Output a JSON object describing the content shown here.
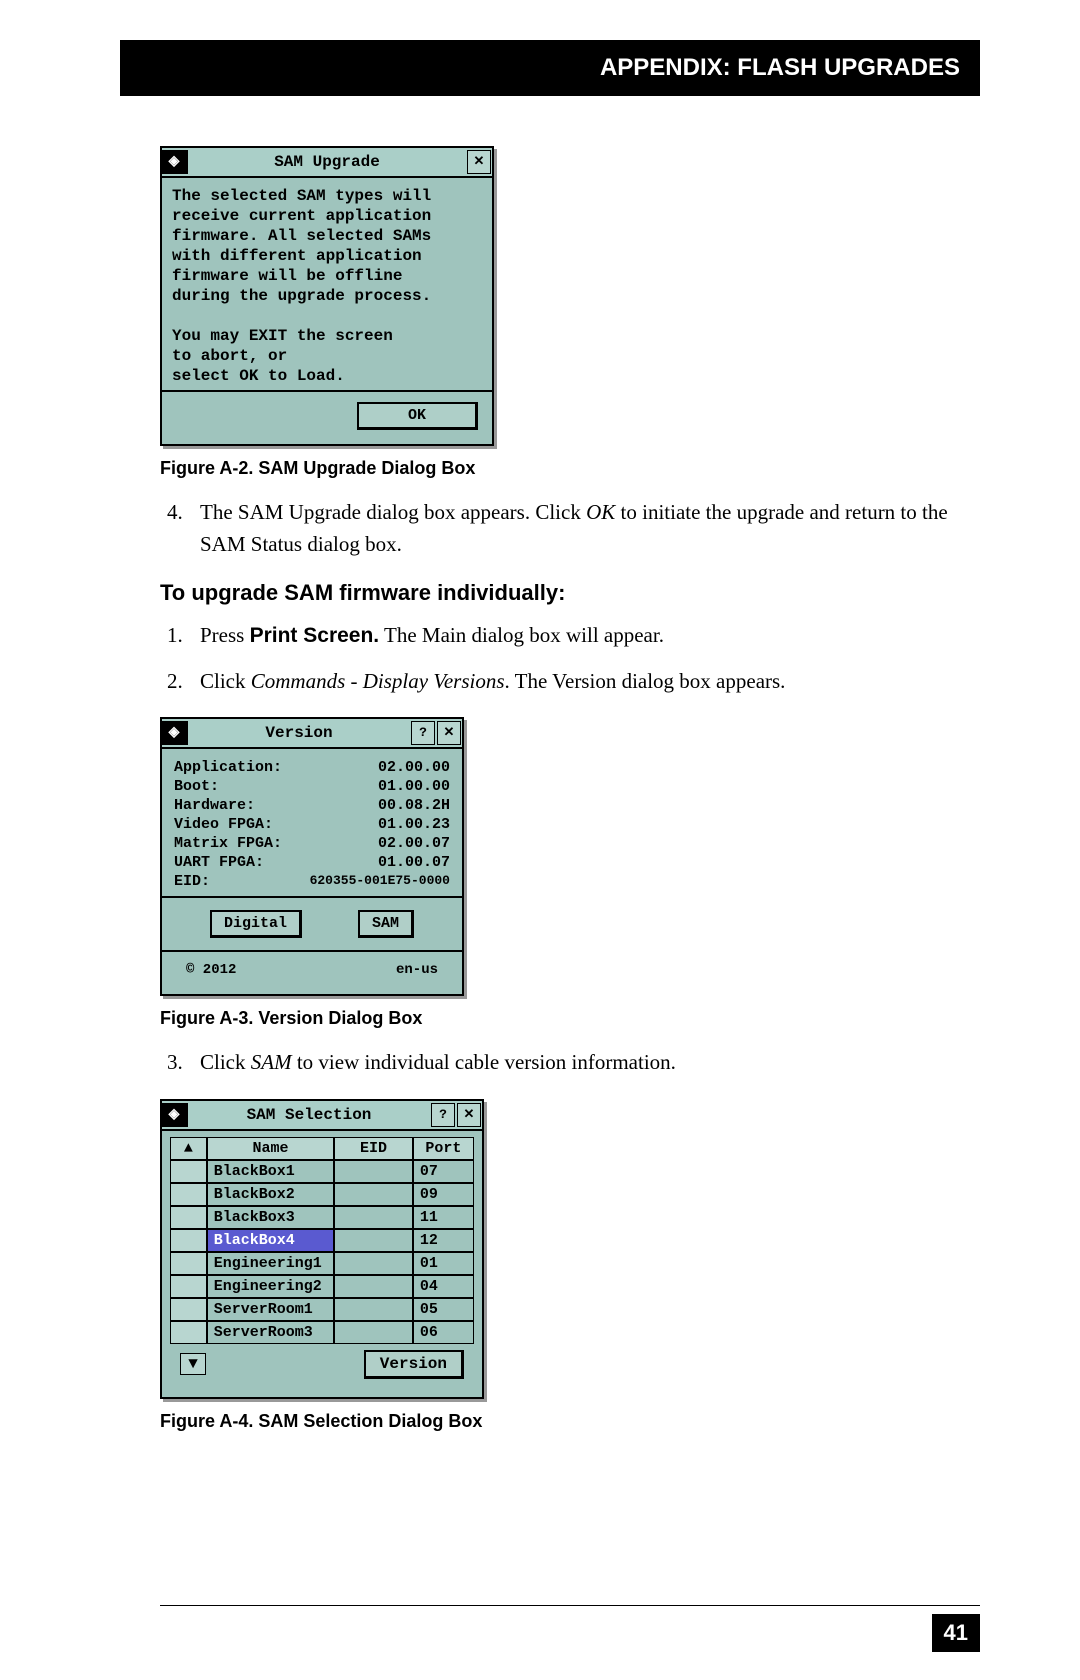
{
  "header": {
    "title": "APPENDIX: FLASH UPGRADES"
  },
  "dialog_a2": {
    "title": "SAM Upgrade",
    "body": "The selected SAM types will\nreceive current application\nfirmware. All selected SAMs\nwith different application\nfirmware will be offline\nduring the upgrade process.\n\nYou may EXIT the screen\nto abort, or\nselect OK to Load.",
    "ok": "OK"
  },
  "caption_a2": "Figure A-2. SAM Upgrade Dialog Box",
  "step4": {
    "num": "4.",
    "text_a": "The SAM Upgrade dialog box appears. Click ",
    "em": "OK",
    "text_b": " to initiate the upgrade and return to the SAM Status dialog box."
  },
  "section2": "To upgrade SAM firmware individually:",
  "step1": {
    "text_a": "Press ",
    "bold": "Print Screen.",
    "text_b": " The Main dialog box will appear."
  },
  "step2": {
    "text_a": "Click ",
    "em": "Commands - Display Versions",
    "text_b": ". The Version dialog box appears."
  },
  "dialog_a3": {
    "title": "Version",
    "rows": [
      {
        "label": "Application:",
        "value": "02.00.00"
      },
      {
        "label": "Boot:",
        "value": "01.00.00"
      },
      {
        "label": "Hardware:",
        "value": "00.08.2H"
      },
      {
        "label": "Video FPGA:",
        "value": "01.00.23"
      },
      {
        "label": "Matrix FPGA:",
        "value": "02.00.07"
      },
      {
        "label": "UART FPGA:",
        "value": "01.00.07"
      }
    ],
    "eid": {
      "label": "EID:",
      "value": "620355-001E75-0000"
    },
    "btn_left": "Digital",
    "btn_right": "SAM",
    "foot_left": "© 2012",
    "foot_right": "en-us"
  },
  "caption_a3": "Figure A-3. Version Dialog Box",
  "step3": {
    "text_a": "Click ",
    "em": "SAM",
    "text_b": " to view individual cable version information."
  },
  "dialog_a4": {
    "title": "SAM Selection",
    "cols": {
      "sort": "▲",
      "name": "Name",
      "eid": "EID",
      "port": "Port"
    },
    "rows": [
      {
        "name": "BlackBox1",
        "eid": "",
        "port": "07",
        "selected": false
      },
      {
        "name": "BlackBox2",
        "eid": "",
        "port": "09",
        "selected": false
      },
      {
        "name": "BlackBox3",
        "eid": "",
        "port": "11",
        "selected": false
      },
      {
        "name": "BlackBox4",
        "eid": "",
        "port": "12",
        "selected": true
      },
      {
        "name": "Engineering1",
        "eid": "",
        "port": "01",
        "selected": false
      },
      {
        "name": "Engineering2",
        "eid": "",
        "port": "04",
        "selected": false
      },
      {
        "name": "ServerRoom1",
        "eid": "",
        "port": "05",
        "selected": false
      },
      {
        "name": "ServerRoom3",
        "eid": "",
        "port": "06",
        "selected": false
      }
    ],
    "scroll_icon": "▼",
    "version_btn": "Version"
  },
  "caption_a4": "Figure A-4. SAM Selection Dialog Box",
  "page_number": "41"
}
